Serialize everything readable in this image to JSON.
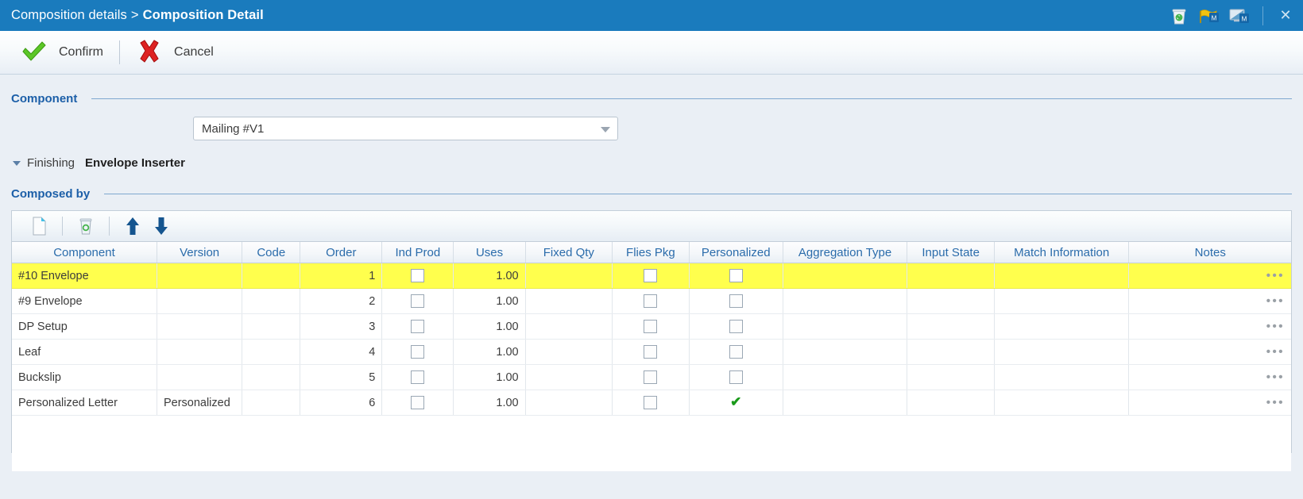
{
  "titlebar": {
    "breadcrumb_parent": "Composition details",
    "breadcrumb_separator": ">",
    "breadcrumb_current": "Composition Detail",
    "close_label": "✕",
    "accent_color": "#1a7bbd",
    "icons": [
      "trash-bin-icon",
      "yellow-flag-badge-icon",
      "screen-badge-icon"
    ]
  },
  "toolbar": {
    "confirm_label": "Confirm",
    "cancel_label": "Cancel"
  },
  "component_section": {
    "title": "Component",
    "dropdown_value": "Mailing #V1",
    "finishing_label": "Finishing",
    "finishing_value": "Envelope Inserter"
  },
  "composed_by_section": {
    "title": "Composed by",
    "grid_toolbar": {
      "new_label": "new-document-icon",
      "delete_label": "trash-bin-icon",
      "move_up_label": "arrow-up-icon",
      "move_down_label": "arrow-down-icon"
    },
    "columns": [
      "Component",
      "Version",
      "Code",
      "Order",
      "Ind Prod",
      "Uses",
      "Fixed Qty",
      "Flies Pkg",
      "Personalized",
      "Aggregation Type",
      "Input State",
      "Match Information",
      "Notes"
    ],
    "rows": [
      {
        "component": "#10 Envelope",
        "version": "",
        "code": "",
        "order": "1",
        "ind_prod": false,
        "uses": "1.00",
        "fixed_qty": "",
        "flies_pkg": false,
        "personalized": false,
        "aggregation_type": "",
        "input_state": "",
        "match_information": "",
        "notes": "•••",
        "selected": true
      },
      {
        "component": "#9 Envelope",
        "version": "",
        "code": "",
        "order": "2",
        "ind_prod": false,
        "uses": "1.00",
        "fixed_qty": "",
        "flies_pkg": false,
        "personalized": false,
        "aggregation_type": "",
        "input_state": "",
        "match_information": "",
        "notes": "•••",
        "selected": false
      },
      {
        "component": "DP Setup",
        "version": "",
        "code": "",
        "order": "3",
        "ind_prod": false,
        "uses": "1.00",
        "fixed_qty": "",
        "flies_pkg": false,
        "personalized": false,
        "aggregation_type": "",
        "input_state": "",
        "match_information": "",
        "notes": "•••",
        "selected": false
      },
      {
        "component": "Leaf",
        "version": "",
        "code": "",
        "order": "4",
        "ind_prod": false,
        "uses": "1.00",
        "fixed_qty": "",
        "flies_pkg": false,
        "personalized": false,
        "aggregation_type": "",
        "input_state": "",
        "match_information": "",
        "notes": "•••",
        "selected": false
      },
      {
        "component": "Buckslip",
        "version": "",
        "code": "",
        "order": "5",
        "ind_prod": false,
        "uses": "1.00",
        "fixed_qty": "",
        "flies_pkg": false,
        "personalized": false,
        "aggregation_type": "",
        "input_state": "",
        "match_information": "",
        "notes": "•••",
        "selected": false
      },
      {
        "component": "Personalized Letter",
        "version": "Personalized",
        "code": "",
        "order": "6",
        "ind_prod": false,
        "uses": "1.00",
        "fixed_qty": "",
        "flies_pkg": false,
        "personalized": true,
        "aggregation_type": "",
        "input_state": "",
        "match_information": "",
        "notes": "•••",
        "selected": false
      }
    ]
  }
}
